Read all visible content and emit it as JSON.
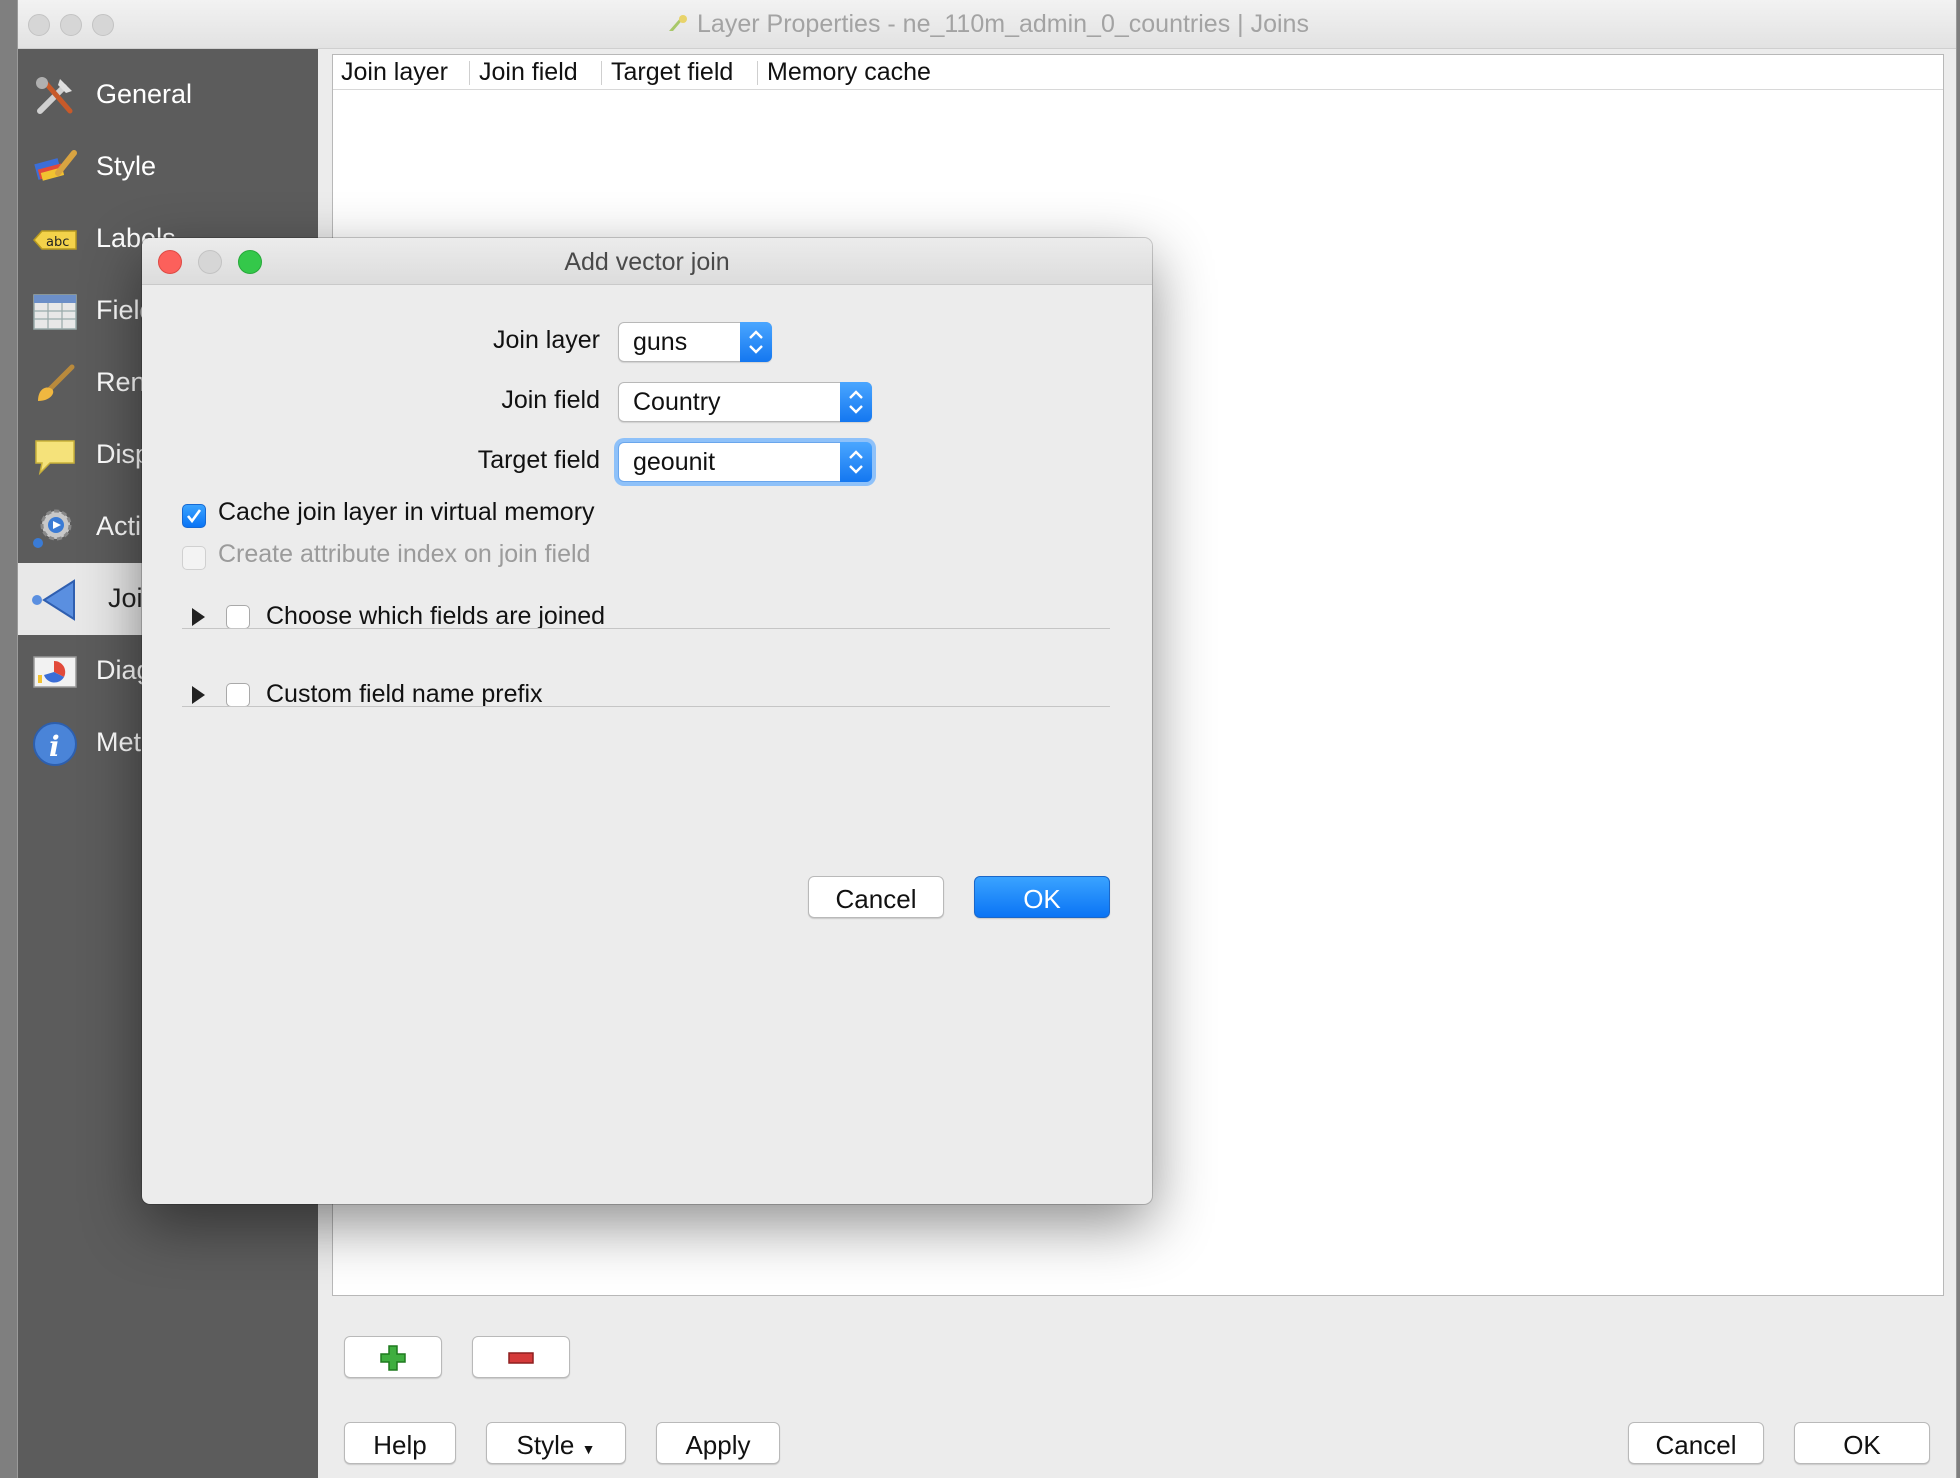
{
  "window": {
    "title": "Layer Properties - ne_110m_admin_0_countries | Joins"
  },
  "sidebar": {
    "items": [
      {
        "label": "General",
        "icon": "tools-icon"
      },
      {
        "label": "Style",
        "icon": "paint-brush-icon"
      },
      {
        "label": "Labels",
        "icon": "abc-label-icon"
      },
      {
        "label": "Field",
        "icon": "table-icon"
      },
      {
        "label": "Ren",
        "icon": "brush-icon"
      },
      {
        "label": "Disp",
        "icon": "speech-bubble-icon"
      },
      {
        "label": "Acti",
        "icon": "gear-icon"
      },
      {
        "label": "Joi",
        "icon": "join-arrow-icon"
      },
      {
        "label": "Diag",
        "icon": "diagram-icon"
      },
      {
        "label": "Met",
        "icon": "info-icon"
      }
    ]
  },
  "joins_table": {
    "columns": [
      "Join layer",
      "Join field",
      "Target field",
      "Memory cache"
    ]
  },
  "footer": {
    "help": "Help",
    "style": "Style",
    "apply": "Apply",
    "cancel": "Cancel",
    "ok": "OK"
  },
  "dialog": {
    "title": "Add vector join",
    "join_layer_label": "Join layer",
    "join_layer_value": "guns",
    "join_field_label": "Join field",
    "join_field_value": "Country",
    "target_field_label": "Target field",
    "target_field_value": "geounit",
    "cache_label": "Cache join layer in virtual memory",
    "cache_checked": true,
    "index_label": "Create attribute index on join field",
    "index_checked": false,
    "choose_fields_label": "Choose which fields are joined",
    "prefix_label": "Custom field name prefix",
    "cancel": "Cancel",
    "ok": "OK"
  },
  "colors": {
    "sidebar_bg": "#5c5c5c",
    "accent_blue": "#1477f0",
    "close_red": "#fc605b",
    "zoom_green": "#34c84a"
  }
}
